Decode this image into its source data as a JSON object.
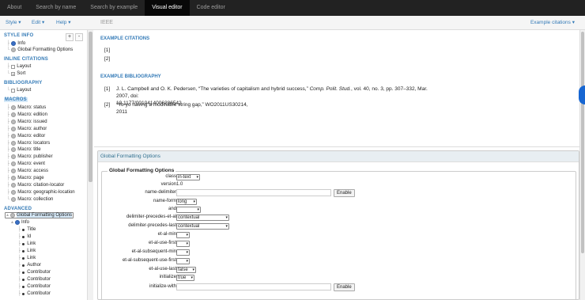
{
  "nav": {
    "tabs": [
      "About",
      "Search by name",
      "Search by example",
      "Visual editor",
      "Code editor"
    ],
    "active": 3
  },
  "menubar": {
    "style_menu": "Style",
    "edit_menu": "Edit",
    "help_menu": "Help",
    "style_name": "IEEE",
    "example_menu": "Example citations"
  },
  "sidebar": {
    "style_info": "STYLE INFO",
    "info_label": "Info",
    "global_opts": "Global Formatting Options",
    "inline_citations": "INLINE CITATIONS",
    "layout": "Layout",
    "sort": "Sort",
    "bibliography": "BIBLIOGRAPHY",
    "bib_layout": "Layout",
    "macros": "MACROS",
    "macro_items": [
      "Macro: status",
      "Macro: edition",
      "Macro: issued",
      "Macro: author",
      "Macro: editor",
      "Macro: locators",
      "Macro: title",
      "Macro: publisher",
      "Macro: event",
      "Macro: access",
      "Macro: page",
      "Macro: citation-locator",
      "Macro: geographic-location",
      "Macro: collection"
    ],
    "advanced": "ADVANCED",
    "adv_global": "Global Formatting Options",
    "adv_info": "Info",
    "adv_children": [
      "Title",
      "Id",
      "Link",
      "Link",
      "Link",
      "Author",
      "Contributor",
      "Contributor",
      "Contributor",
      "Contributor"
    ],
    "plus": "+",
    "minus": "-"
  },
  "main": {
    "example_citations": "EXAMPLE CITATIONS",
    "citations": [
      "[1]",
      "[2]"
    ],
    "example_bibliography": "EXAMPLE BIBLIOGRAPHY",
    "bib": [
      {
        "num": "[1]",
        "pre": "J. L. Campbell and O. K. Pedersen, “The varieties of capitalism and hybrid success,” ",
        "journal": "Comp. Polit. Stud.",
        "post": ", vol. 40, no. 3, pp. 307–332, Mar. 2007, doi:",
        "line2": "10.1177/0010414006286542"
      },
      {
        "num": "[2]",
        "line1": "“Yo-yo having a modifiable string gap,” WO2011US30214,",
        "line2": "2011"
      }
    ],
    "panel_title": "Global Formatting Options",
    "fieldset_legend": "Global Formatting Options",
    "fields": {
      "class_label": "class",
      "class_value": "in-text",
      "version_label": "version",
      "version_value": "1.0",
      "name_delimiter_label": "name-delimiter",
      "enable": "Enable",
      "name_form_label": "name-form",
      "name_form_value": "long",
      "and_label": "and",
      "and_value": "",
      "dpea_label": "delimiter-precedes-et-al",
      "dpea_value": "contextual",
      "dpl_label": "delimiter-precedes-last",
      "dpl_value": "contextual",
      "etal_min_label": "et-al-min",
      "etal_min_value": "",
      "etal_first_label": "et-al-use-first",
      "etal_first_value": "",
      "etal_sub_min_label": "et-al-subsequent-min",
      "etal_sub_min_value": "",
      "etal_sub_first_label": "et-al-subsequent-use-first",
      "etal_sub_first_value": "",
      "etal_last_label": "et-al-use-last",
      "etal_last_value": "false",
      "initialize_label": "initialize",
      "initialize_value": "true",
      "initialize_with_label": "initialize-with",
      "enable2": "Enable"
    }
  }
}
